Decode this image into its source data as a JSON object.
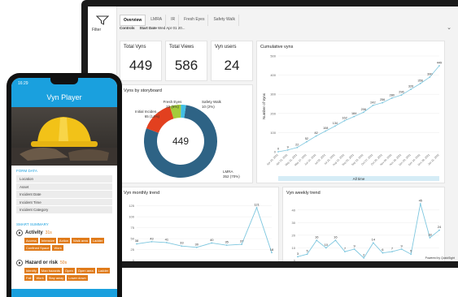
{
  "filter": {
    "label": "Filter"
  },
  "tabs": [
    "Overview",
    "LMRA",
    "IR",
    "Fresh Eyes",
    "Safety Walk"
  ],
  "controls": {
    "label": "Controls",
    "start_date_label": "Start Date",
    "start_date_value": "Wed Apr 01 20..."
  },
  "kpis": [
    {
      "label": "Total Vyns",
      "value": "449"
    },
    {
      "label": "Total Views",
      "value": "586"
    },
    {
      "label": "Vyn users",
      "value": "24"
    }
  ],
  "colors": {
    "accent": "#1aa0de",
    "orange": "#e07b1a",
    "line": "#7ec7df"
  },
  "chart_data": [
    {
      "type": "pie",
      "title": "Vyns by storyboard",
      "center_label": "449",
      "slices": [
        {
          "label": "LMRA",
          "value": 352,
          "pct": "70%",
          "color": "#2e6385"
        },
        {
          "label": "Initial Inciden...",
          "value": 65,
          "pct": "14%",
          "color": "#e2401f"
        },
        {
          "label": "Fresh Eyes",
          "value": 22,
          "pct": "5%",
          "color": "#a4cc3b"
        },
        {
          "label": "Safety Walk",
          "value": 10,
          "pct": "2%",
          "color": "#40bfe6"
        }
      ],
      "slice_labels": [
        "LMRA",
        "352 (70%)",
        "Initial Inciden...",
        "65 (14%)",
        "Fresh Eyes",
        "22 (5%)",
        "Safety Walk",
        "10 (2%)"
      ]
    },
    {
      "type": "line",
      "title": "Cumulative vyns",
      "ylabel": "Number of Vyns",
      "xlabel": "All time",
      "ylim": [
        0,
        500
      ],
      "yticks": [
        "0",
        "100",
        "200",
        "300",
        "400",
        "500"
      ],
      "values": [
        0,
        9,
        22,
        52,
        82,
        108,
        134,
        162,
        184,
        206,
        242,
        256,
        280,
        296,
        326,
        356,
        390,
        449
      ],
      "data_labels": [
        "0",
        "9",
        "22",
        "52",
        "82",
        "108",
        "134",
        "162",
        "184",
        "206",
        "242",
        "256",
        "280",
        "296",
        "326",
        "356",
        "390",
        "449"
      ],
      "x": [
        "Apr 10, 2021",
        "Apr 21, 2021",
        "May 11, 2021",
        "May 27, 2021",
        "Jun 15, 2021",
        "Jul 02, 2021",
        "Jul 21, 2021",
        "Aug 12, 2021",
        "Sep 01, 2021",
        "Sep 22, 2021",
        "Oct 07, 2021",
        "Oct 20, 2021",
        "Nov 04, 2021",
        "Nov 18, 2021",
        "Dec 02, 2021",
        "Dec 14, 2021",
        "Dec 28, 2021",
        "Jan 11, 2022"
      ]
    },
    {
      "type": "line",
      "title": "Vyn monthly trend",
      "ylim": [
        0,
        130
      ],
      "yticks": [
        "0",
        "25",
        "50",
        "75",
        "100",
        "125"
      ],
      "values": [
        38,
        43,
        41,
        33,
        30,
        40,
        35,
        37,
        121,
        18
      ],
      "data_labels": [
        "38",
        "43",
        "41",
        "33",
        "30",
        "40",
        "35",
        "37",
        "121",
        "18"
      ]
    },
    {
      "type": "line",
      "title": "Vyn weekly trend",
      "ylim": [
        0,
        45
      ],
      "yticks": [
        "0",
        "10",
        "20",
        "30",
        "40"
      ],
      "values": [
        3,
        5,
        16,
        10,
        16,
        7,
        9,
        2,
        14,
        6,
        7,
        9,
        5,
        45,
        18,
        24
      ],
      "data_labels": [
        "3",
        "5",
        "16",
        "10",
        "16",
        "7",
        "9",
        "2",
        "14",
        "6",
        "7",
        "9",
        "5",
        "45",
        "18",
        "24"
      ]
    }
  ],
  "powered_by": "Powered by QuickSight",
  "phone": {
    "time": "16:29",
    "app_title": "Vyn Player",
    "form_section": "FORM DATA",
    "fields": [
      "Location",
      "Asset",
      "Incident Date",
      "Incident Time",
      "Incident Category"
    ],
    "summary_section": "SMART SUMMARY",
    "activity": {
      "label": "Activity",
      "duration": "31s",
      "tags": [
        "Access",
        "Intensive",
        "Action",
        "Walk area",
        "Ladder",
        "Confined Space",
        "Work"
      ]
    },
    "hazard": {
      "label": "Hazard or risk",
      "duration": "50s",
      "tags": [
        "Identify",
        "Man hazards",
        "Open",
        "Open area",
        "Ladder",
        "Fall",
        "Work",
        "Stay away",
        "Lower down"
      ]
    }
  }
}
